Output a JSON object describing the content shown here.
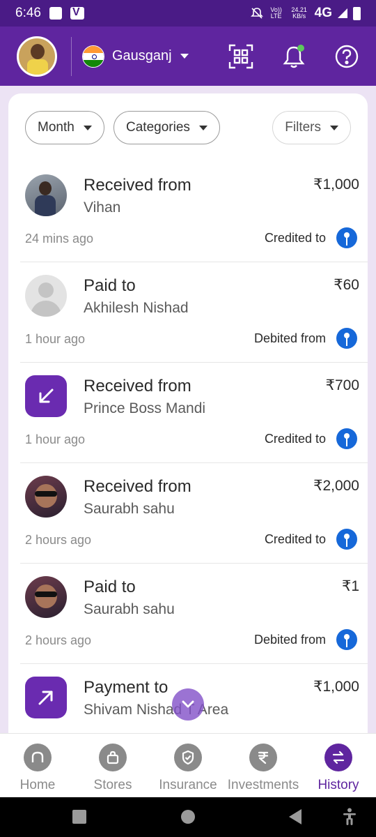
{
  "status_bar": {
    "time": "6:46",
    "volte": "Vo)) LTE",
    "speed": "24.21 KB/s",
    "network": "4G"
  },
  "header": {
    "location": "Gausganj",
    "icons": [
      "qr-code-icon",
      "bell-icon",
      "help-icon"
    ],
    "colors": {
      "header_bg": "#5f259f",
      "status_bg": "#4a1b86",
      "notification_dot": "#5cc85c"
    }
  },
  "filters": {
    "month": "Month",
    "categories": "Categories",
    "filters": "Filters"
  },
  "transactions": [
    {
      "type": "Received from",
      "name": "Vihan",
      "amount": "₹1,000",
      "time": "24 mins ago",
      "account": "Credited to",
      "avatar": "photo"
    },
    {
      "type": "Paid to",
      "name": "Akhilesh Nishad",
      "amount": "₹60",
      "time": "1 hour ago",
      "account": "Debited from",
      "avatar": "default"
    },
    {
      "type": "Received from",
      "name": "Prince Boss Mandi",
      "amount": "₹700",
      "time": "1 hour ago",
      "account": "Credited to",
      "avatar": "arrow-in-icon"
    },
    {
      "type": "Received from",
      "name": "Saurabh sahu",
      "amount": "₹2,000",
      "time": "2 hours ago",
      "account": "Credited to",
      "avatar": "photo"
    },
    {
      "type": "Paid to",
      "name": "Saurabh sahu",
      "amount": "₹1",
      "time": "2 hours ago",
      "account": "Debited from",
      "avatar": "photo"
    },
    {
      "type": "Payment to",
      "name": "Shivam Nishad T Area",
      "amount": "₹1,000",
      "time": "",
      "account": "",
      "avatar": "arrow-out-icon"
    }
  ],
  "bottom_nav": [
    {
      "label": "Home",
      "icon": "home-icon",
      "active": false
    },
    {
      "label": "Stores",
      "icon": "store-bag-icon",
      "active": false
    },
    {
      "label": "Insurance",
      "icon": "shield-check-icon",
      "active": false
    },
    {
      "label": "Investments",
      "icon": "rupee-icon",
      "active": false
    },
    {
      "label": "History",
      "icon": "swap-arrows-icon",
      "active": true
    }
  ]
}
